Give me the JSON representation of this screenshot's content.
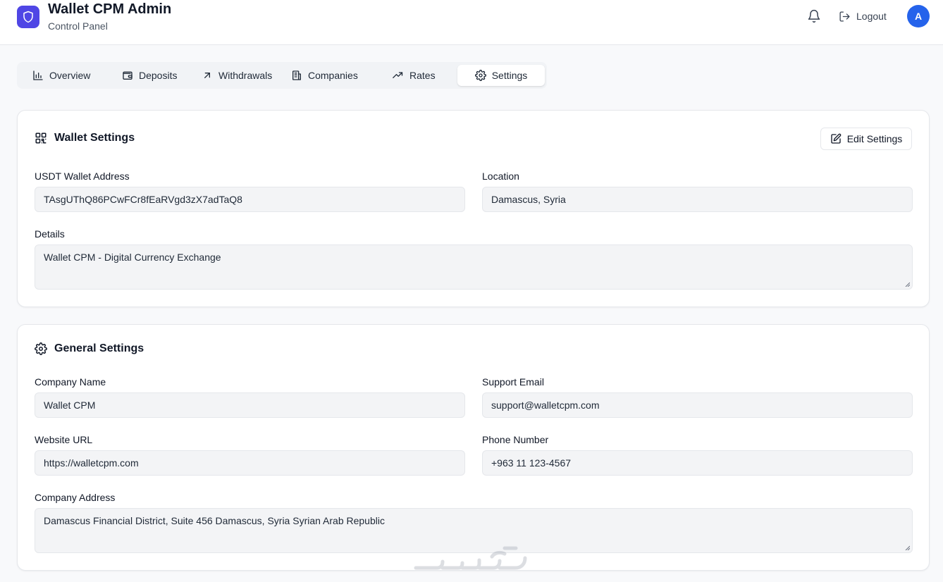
{
  "header": {
    "title": "Wallet CPM Admin",
    "subtitle": "Control Panel",
    "logout_label": "Logout",
    "avatar_initial": "A",
    "brand_color": "#4f46e5",
    "avatar_color": "#2563eb"
  },
  "tabs": [
    {
      "label": "Overview",
      "icon": "bar-chart-icon",
      "active": false
    },
    {
      "label": "Deposits",
      "icon": "wallet-icon",
      "active": false
    },
    {
      "label": "Withdrawals",
      "icon": "arrow-up-right-icon",
      "active": false
    },
    {
      "label": "Companies",
      "icon": "building-icon",
      "active": false
    },
    {
      "label": "Rates",
      "icon": "trending-up-icon",
      "active": false
    },
    {
      "label": "Settings",
      "icon": "gear-icon",
      "active": true
    }
  ],
  "wallet_settings": {
    "title": "Wallet Settings",
    "edit_label": "Edit Settings",
    "usdt_label": "USDT Wallet Address",
    "usdt_value": "TAsgUThQ86PCwFCr8fEaRVgd3zX7adTaQ8",
    "location_label": "Location",
    "location_value": "Damascus, Syria",
    "details_label": "Details",
    "details_value": "Wallet CPM - Digital Currency Exchange"
  },
  "general_settings": {
    "title": "General Settings",
    "company_name_label": "Company Name",
    "company_name_value": "Wallet CPM",
    "support_email_label": "Support Email",
    "support_email_value": "support@walletcpm.com",
    "website_label": "Website URL",
    "website_value": "https://walletcpm.com",
    "phone_label": "Phone Number",
    "phone_value": "+963 11 123-4567",
    "address_label": "Company Address",
    "address_value": "Damascus Financial District, Suite 456 Damascus, Syria Syrian Arab Republic"
  },
  "watermark": {
    "text": "خمسات"
  }
}
